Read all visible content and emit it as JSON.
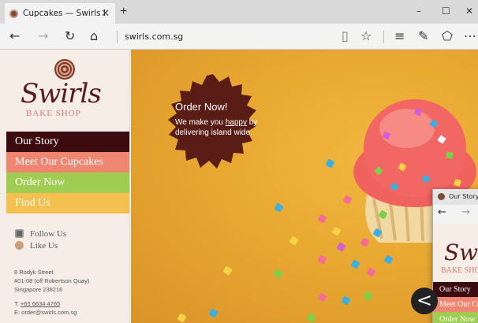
{
  "tab": {
    "title": "Cupcakes — Swirls Bake",
    "close": "✕",
    "new_tab": "+"
  },
  "window": {
    "minimize": "–",
    "maximize": "☐",
    "close": "✕"
  },
  "nav": {
    "back": "←",
    "forward": "→",
    "refresh": "↻",
    "home": "⌂",
    "url": "swirls.com.sg",
    "reading": "▯",
    "favorite": "☆",
    "hub": "≡",
    "note": "✎",
    "share": "⬠",
    "more": "⋯"
  },
  "brand": {
    "name": "Swirls",
    "tagline": "BAKE SHOP"
  },
  "menu": {
    "items": [
      {
        "label": "Our Story"
      },
      {
        "label": "Meet Our Cupcakes"
      },
      {
        "label": "Order Now"
      },
      {
        "label": "Find Us"
      }
    ]
  },
  "social": {
    "follow": "Follow Us",
    "like": "Like Us"
  },
  "address": {
    "line1": "8 Rodyk Street",
    "line2": "#01-08 (off Robertson Quay)",
    "line3": "Singapore 238216"
  },
  "contact": {
    "tel_prefix": "T: ",
    "tel": "+65 6634 4765",
    "email_prefix": "E: ",
    "email": "order@swirls.com.sg"
  },
  "hero": {
    "badge_title": "Order Now!",
    "badge_text_a": "We make you ",
    "badge_text_happy": "happy",
    "badge_text_b": " by delivering island wide."
  },
  "mini_window": {
    "tab_title": "Our Story -",
    "back": "←",
    "forward": "→",
    "brand": "Swirls",
    "tagline": "BAKE SHOP",
    "menu": [
      "Our Story",
      "Meet Our Cu",
      "Order Now"
    ]
  },
  "overlay": {
    "back_glyph": "<"
  },
  "colors": {
    "maroon": "#3b0b0f",
    "salmon": "#ee8672",
    "green": "#9fcd52",
    "yellow": "#f4c04f",
    "badge": "#5a1d16"
  }
}
